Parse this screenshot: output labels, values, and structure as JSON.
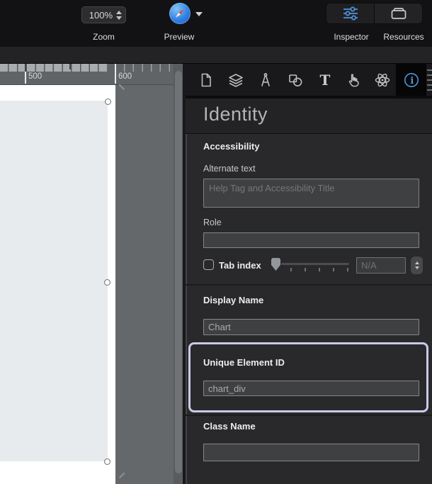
{
  "toolbar": {
    "zoom_value": "100%",
    "zoom_caption": "Zoom",
    "preview_caption": "Preview",
    "inspector_caption": "Inspector",
    "resources_caption": "Resources"
  },
  "ruler": {
    "labels": [
      "500",
      "600"
    ]
  },
  "inspector_tabs": {
    "icons": [
      "document-inspector",
      "scene-layers-inspector",
      "metrics-inspector",
      "element-inspector",
      "typography-inspector",
      "actions-inspector",
      "physics-inspector",
      "identity-inspector"
    ],
    "selected": "identity-inspector",
    "accent_color": "#4e95de"
  },
  "panel": {
    "title": "Identity",
    "accessibility": {
      "header": "Accessibility",
      "alternate_text_label": "Alternate text",
      "alternate_text_placeholder": "Help Tag and Accessibility Title",
      "role_label": "Role",
      "tab_index_label": "Tab index",
      "tab_index_value": "N/A"
    },
    "display_name": {
      "header": "Display Name",
      "value": "Chart"
    },
    "unique_element_id": {
      "header": "Unique Element ID",
      "value": "chart_div",
      "highlight_color": "#c9cae9"
    },
    "class_name": {
      "header": "Class Name",
      "value": ""
    }
  },
  "colors": {
    "toolbar_bg": "#121214",
    "panel_bg": "#29292b",
    "canvas_element": "#e8ebed",
    "pasteboard": "#65686b",
    "highlight_border": "#c9cae9",
    "accent_blue": "#4e95de"
  }
}
